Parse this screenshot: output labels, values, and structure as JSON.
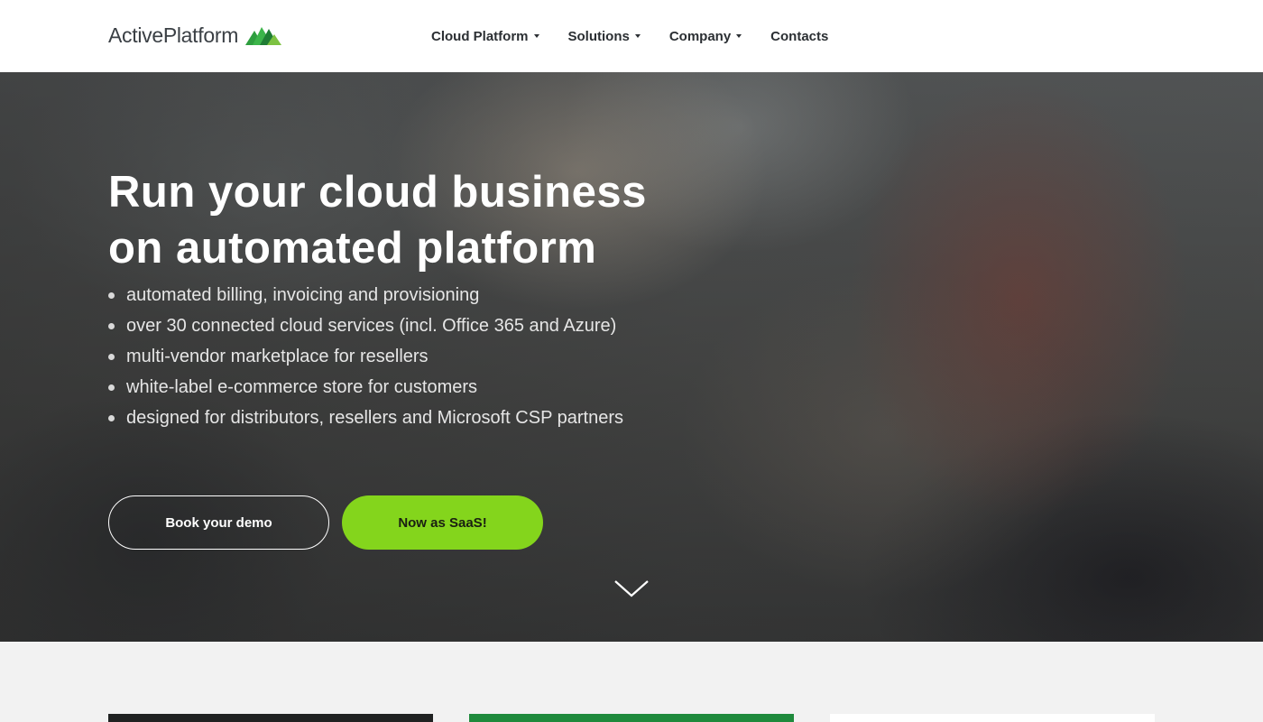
{
  "header": {
    "logo_text": "ActivePlatform",
    "nav": [
      {
        "label": "Cloud Platform",
        "has_dropdown": true
      },
      {
        "label": "Solutions",
        "has_dropdown": true
      },
      {
        "label": "Company",
        "has_dropdown": true
      },
      {
        "label": "Contacts",
        "has_dropdown": false
      }
    ]
  },
  "hero": {
    "title_line1": "Run your cloud business",
    "title_line2": "on automated platform",
    "bullets": [
      "automated billing, invoicing and provisioning",
      "over 30 connected cloud services (incl. Office 365 and Azure)",
      "multi-vendor marketplace for resellers",
      "white-label e-commerce store for customers",
      "designed for distributors, resellers and Microsoft CSP partners"
    ],
    "btn_demo": "Book your demo",
    "btn_saas": "Now as SaaS!"
  },
  "colors": {
    "accent_green": "#84d51c",
    "logo_green": "#2e9e3f",
    "nav_text": "#2b2f33"
  },
  "icons": {
    "logo_mark": "logo-mountain-icon",
    "caret": "caret-down-icon",
    "scroll": "chevron-down-icon"
  }
}
